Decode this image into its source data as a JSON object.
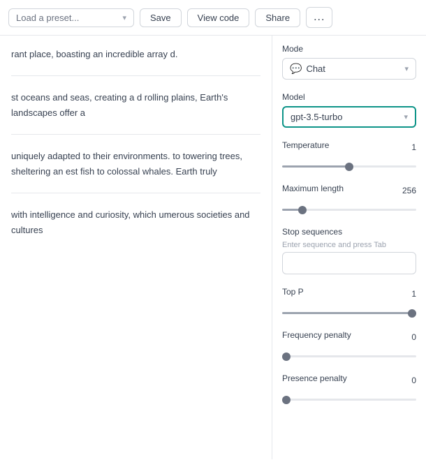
{
  "toolbar": {
    "preset_placeholder": "Load a preset...",
    "save_label": "Save",
    "view_code_label": "View code",
    "share_label": "Share",
    "more_label": "..."
  },
  "settings": {
    "mode_label": "Mode",
    "mode_value": "Chat",
    "mode_icon": "💬",
    "model_label": "Model",
    "model_value": "gpt-3.5-turbo",
    "temperature_label": "Temperature",
    "temperature_value": "1",
    "temperature_slider": 50,
    "max_length_label": "Maximum length",
    "max_length_value": "256",
    "max_length_slider": 13,
    "stop_sequences_label": "Stop sequences",
    "stop_sequences_hint": "Enter sequence and press Tab",
    "stop_sequences_value": "",
    "top_p_label": "Top P",
    "top_p_value": "1",
    "top_p_slider": 100,
    "frequency_penalty_label": "Frequency penalty",
    "frequency_penalty_value": "0",
    "frequency_penalty_slider": 0,
    "presence_penalty_label": "Presence penalty",
    "presence_penalty_value": "0",
    "presence_penalty_slider": 0
  },
  "content": {
    "section1": "rant place, boasting an incredible array d.",
    "section2": "st oceans and seas, creating a d rolling plains, Earth's landscapes offer a",
    "section3": "uniquely adapted to their environments. to towering trees, sheltering an est fish to colossal whales. Earth truly",
    "section4": "with intelligence and curiosity, which umerous societies and cultures"
  }
}
